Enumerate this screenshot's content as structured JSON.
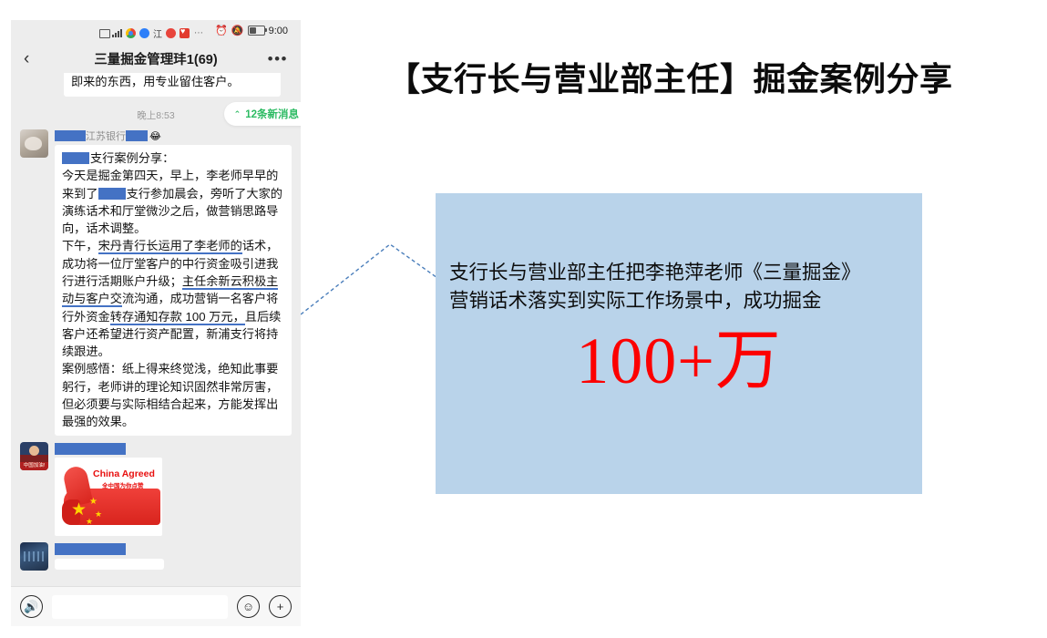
{
  "phone": {
    "status_bar": {
      "time": "9:00",
      "icons": [
        "sim-card-icon",
        "signal-bars-icon",
        "chrome-icon",
        "browser-icon",
        "input-method-icon",
        "app-red-icon",
        "heart-app-icon",
        "overflow-dots-icon"
      ],
      "right_icons": [
        "alarm-clock-icon",
        "mute-bell-icon",
        "battery-icon"
      ]
    },
    "nav": {
      "back_label": "‹",
      "title": "三量掘金管理玤1(69)",
      "more_label": "•••"
    },
    "chat": {
      "top_bubble_text": "即来的东西，用专业留住客户。",
      "new_messages_pill": "12条新消息",
      "new_messages_chevron": "⌃",
      "timestamp": "晚上8:53",
      "sender": {
        "name": "江苏银行",
        "emoji": "😂",
        "avatar": "cat-avatar"
      },
      "message": {
        "heading": "支行案例分享：",
        "para1": "今天是掘金第四天，早上，李老师早早的来到了",
        "para1b": "支行参加晨会，旁听了大家的演练话术和厅堂微沙之后，做营销思路导向，话术调整。",
        "para2_prefix": "下午，",
        "para2_underline1": "宋丹青行长运用了李老师的",
        "para2_mid": "话术，成功将一位厅堂客户的中行资金吸引进我行进行活期账户升级；",
        "para2_underline2": "主任余新云积极主动与客户交",
        "para2_mid2": "流沟通，成功营销一名客户将行外资金",
        "para2_underline3": "转存通知存款 100 万元，",
        "para2_tail": "且后续客户还希望进行资产配置，新浦支行将持续跟进。",
        "para3": "案例感悟：纸上得来终觉浅，绝知此事要躬行，老师讲的理论知识固然非常厉害，但必须要与实际相结合起来，方能发挥出最强的效果。"
      },
      "image_message": {
        "caption_en": "China Agreed",
        "caption_cn": "全中国为你点赞",
        "avatar": "man-avatar",
        "avatar_caption": "中国加油!"
      },
      "last_message": {
        "avatar": "night-scene-avatar"
      }
    },
    "input_bar": {
      "voice_icon": "voice-wave-icon",
      "placeholder": "",
      "value": "",
      "emoji_icon": "smiley-face-icon",
      "plus_icon": "plus-circle-icon"
    }
  },
  "slide": {
    "title": "【支行长与营业部主任】掘金案例分享",
    "callout": {
      "line1": "支行长与营业部主任把李艳萍老师《三量掘金》",
      "line2": "营销话术落实到实际工作场景中，成功掘金",
      "big_number": "100+万",
      "box_color": "#b9d3ea",
      "big_number_color": "#fc0000"
    },
    "connector": "dashed-leader-line"
  }
}
